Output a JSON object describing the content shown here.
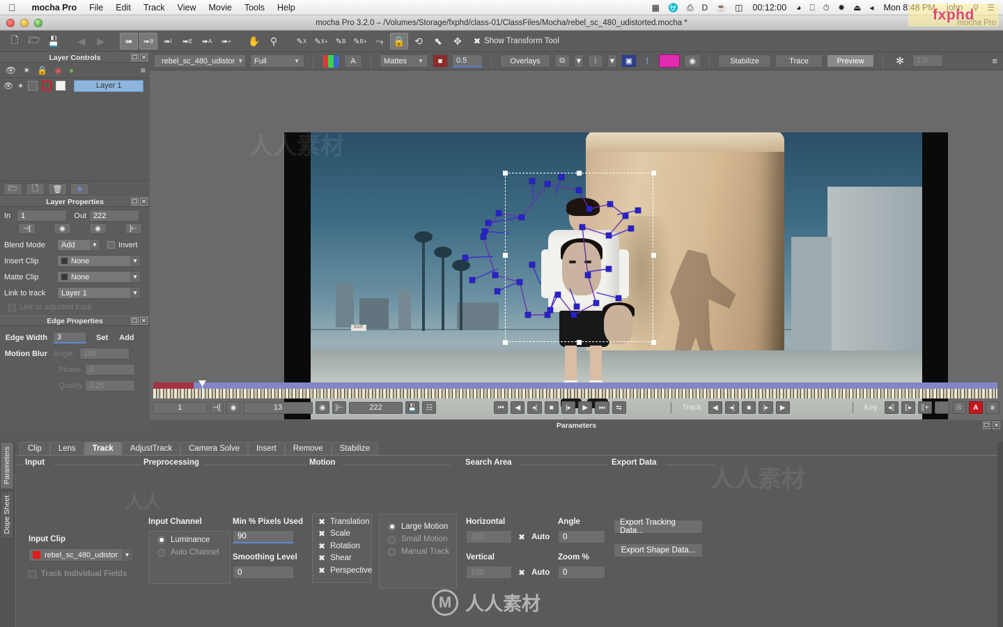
{
  "macbar": {
    "apple": "apple-logo",
    "app": "mocha Pro",
    "menus": [
      "File",
      "Edit",
      "Track",
      "View",
      "Movie",
      "Tools",
      "Help"
    ],
    "status_icons": [
      "film-icon",
      "creative-cloud-icon",
      "display-link-icon",
      "dropbox-icon",
      "bell-icon"
    ],
    "battery": "00:12:00",
    "right_icons": [
      "wifi-icon",
      "screen-share-icon",
      "time-machine-icon",
      "bluetooth-icon",
      "eject-icon",
      "volume-icon"
    ],
    "clock": "Mon 8:48 PM",
    "user": "john",
    "search": "search-icon",
    "notifications": "notification-center-icon",
    "logo": "fxphd"
  },
  "window": {
    "title": "mocha Pro 3.2.0 – /Volumes/Storage/fxphd/class-01/ClassFiles/Mocha/rebel_sc_480_udistorted.mocha *",
    "app_label": "mocha Pro"
  },
  "toolbar": {
    "file_tools": [
      "new-icon",
      "open-icon",
      "save-icon"
    ],
    "nav": [
      "back-arrow-icon",
      "forward-arrow-icon"
    ],
    "tools": [
      {
        "name": "select-tool",
        "glyph": "↖",
        "sup": ""
      },
      {
        "name": "add-point-b-tool",
        "glyph": "↖",
        "sup": "B"
      },
      {
        "name": "insert-point-i-tool",
        "glyph": "↖",
        "sup": "I"
      },
      {
        "name": "edge-point-e-tool",
        "glyph": "↖",
        "sup": "E"
      },
      {
        "name": "all-points-a-tool",
        "glyph": "↖",
        "sup": "A"
      },
      {
        "name": "add-point-plus-tool",
        "glyph": "↖",
        "sup": "+"
      },
      {
        "name": "pan-hand-tool",
        "glyph": "✋",
        "sup": ""
      },
      {
        "name": "zoom-magnifier-tool",
        "glyph": "⚲",
        "sup": ""
      },
      {
        "name": "xspline-tool",
        "glyph": "✒",
        "sup": "X"
      },
      {
        "name": "xspline-add-tool",
        "glyph": "✒",
        "sup": "X+"
      },
      {
        "name": "bezier-tool",
        "glyph": "✒",
        "sup": "B"
      },
      {
        "name": "bezier-add-tool",
        "glyph": "✒",
        "sup": "B+"
      },
      {
        "name": "magnetic-spline-tool",
        "glyph": "⤳",
        "sup": ""
      },
      {
        "name": "link-lock-tool",
        "glyph": "⚿",
        "sup": ""
      },
      {
        "name": "rotate-tool",
        "glyph": "↺",
        "sup": ""
      },
      {
        "name": "scale-tool",
        "glyph": "⧉",
        "sup": ""
      },
      {
        "name": "move-tool",
        "glyph": "✥",
        "sup": ""
      }
    ],
    "show_transform_tool": "Show Transform Tool"
  },
  "viewtoolbar": {
    "clip_name": "rebel_sc_480_udistor",
    "quality": "Full",
    "channels_icon": "rgb-channels-icon",
    "alpha_label": "A",
    "mattes": "Mattes",
    "matte_opacity": "0.5",
    "overlays": "Overlays",
    "stabilize": "Stabilize",
    "trace": "Trace",
    "preview": "Preview",
    "gain": "1.0"
  },
  "layer_controls": {
    "title": "Layer Controls",
    "header_icons": [
      "eye-icon",
      "gear-icon",
      "lock-icon",
      "outline-color-icon",
      "fill-color-icon"
    ],
    "menu_icon": "panel-menu-icon",
    "layers": [
      {
        "name": "Layer 1",
        "visible": true,
        "gear": true,
        "locked": false
      }
    ],
    "tools": [
      "new-group-icon",
      "new-layer-icon",
      "delete-layer-icon",
      "surface-icon"
    ]
  },
  "layer_properties": {
    "title": "Layer Properties",
    "in_label": "In",
    "in_value": "1",
    "out_label": "Out",
    "out_value": "222",
    "io_buttons": [
      "set-in-icon",
      "go-to-in-icon",
      "go-to-out-icon",
      "set-out-icon"
    ],
    "blend_mode_label": "Blend Mode",
    "blend_mode_value": "Add",
    "invert_label": "Invert",
    "insert_clip_label": "Insert Clip",
    "insert_clip_value": "None",
    "matte_clip_label": "Matte Clip",
    "matte_clip_value": "None",
    "link_to_track_label": "Link to track",
    "link_to_track_value": "Layer 1",
    "link_adjusted_label": "Link to adjusted track"
  },
  "edge_properties": {
    "title": "Edge Properties",
    "edge_width_label": "Edge Width",
    "edge_width_value": "3",
    "set_label": "Set",
    "add_label": "Add",
    "motion_blur_label": "Motion Blur",
    "angle_label": "Angle",
    "angle_value": "180",
    "phase_label": "Phase",
    "phase_value": "0",
    "quality_label": "Quality",
    "quality_value": "0.25"
  },
  "transport": {
    "start_frame": "1",
    "current_frame": "13",
    "end_frame": "222",
    "playback_buttons": [
      "go-to-start-icon",
      "play-backward-icon",
      "step-back-icon",
      "stop-icon",
      "step-forward-icon",
      "play-forward-icon",
      "go-to-end-icon",
      "loop-icon"
    ],
    "track_label": "Track",
    "track_buttons": [
      "track-backward-icon",
      "track-back-one-icon",
      "track-stop-icon",
      "track-forward-one-icon",
      "track-forward-icon"
    ],
    "key_label": "Key",
    "key_buttons": [
      "prev-key-icon",
      "next-key-icon",
      "add-key-icon",
      "delete-key-icon",
      "delete-all-keys-icon",
      "auto-key-icon",
      "key-toggle-icon"
    ],
    "in_out_buttons": [
      "set-in-point-icon",
      "set-out-point-icon"
    ],
    "save_buttons": [
      "save-frame-icon",
      "save-range-icon"
    ]
  },
  "parameters_panel": {
    "title": "Parameters",
    "vertical_tabs": [
      "Parameters",
      "Dope Sheet"
    ],
    "tabs": [
      "Clip",
      "Lens",
      "Track",
      "AdjustTrack",
      "Camera Solve",
      "Insert",
      "Remove",
      "Stabilize"
    ],
    "active_tab": "Track",
    "groups": [
      "Input",
      "Preprocessing",
      "Motion",
      "Search Area",
      "Export Data"
    ],
    "input": {
      "input_clip_label": "Input Clip",
      "input_clip_value": "rebel_sc_480_udistor",
      "track_individual_fields": "Track Individual Fields"
    },
    "preprocessing": {
      "input_channel_label": "Input Channel",
      "channels": [
        {
          "label": "Luminance",
          "selected": true
        },
        {
          "label": "Auto Channel",
          "selected": false
        }
      ],
      "min_pct_label": "Min % Pixels Used",
      "min_pct_value": "90",
      "smoothing_label": "Smoothing Level",
      "smoothing_value": "0"
    },
    "motion": {
      "transforms": [
        {
          "label": "Translation",
          "checked": true
        },
        {
          "label": "Scale",
          "checked": true
        },
        {
          "label": "Rotation",
          "checked": true
        },
        {
          "label": "Shear",
          "checked": true
        },
        {
          "label": "Perspective",
          "checked": true
        }
      ],
      "modes": [
        {
          "label": "Large Motion",
          "selected": true
        },
        {
          "label": "Small Motion",
          "selected": false
        },
        {
          "label": "Manual Track",
          "selected": false
        }
      ]
    },
    "search_area": {
      "horizontal_label": "Horizontal",
      "horizontal_value": "100",
      "horizontal_auto": "Auto",
      "vertical_label": "Vertical",
      "vertical_value": "100",
      "vertical_auto": "Auto",
      "angle_label": "Angle",
      "angle_value": "0",
      "zoom_label": "Zoom %",
      "zoom_value": "0"
    },
    "export_data": {
      "export_tracking": "Export Tracking Data...",
      "export_shape": "Export Shape Data..."
    }
  },
  "watermark": {
    "text": "人人素材",
    "mark": "M"
  }
}
